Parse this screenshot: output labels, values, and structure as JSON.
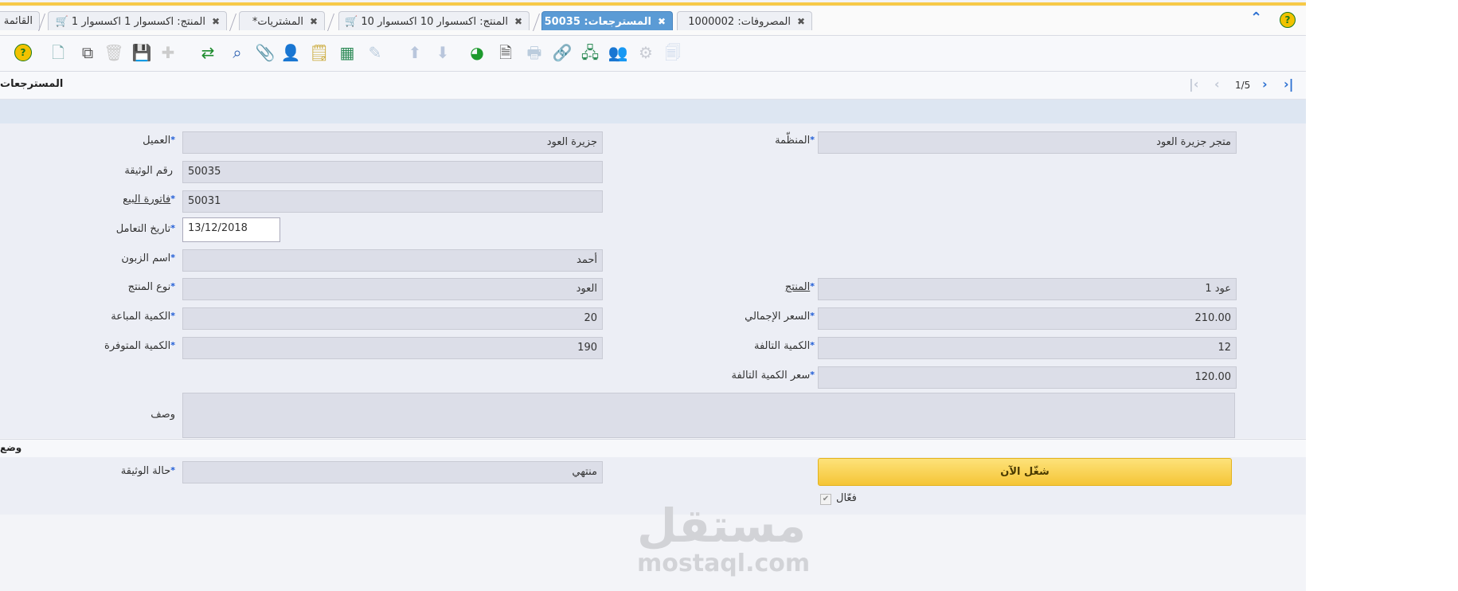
{
  "tabs": [
    {
      "label": "القائمة",
      "active": false
    },
    {
      "label": "المنتج: اكسسوار 1 اكسسوار 1",
      "active": false
    },
    {
      "label": "المشتريات*",
      "active": false
    },
    {
      "label": "المنتج: اكسسوار 10 اكسسوار 10",
      "active": false
    },
    {
      "label": "المسترجعات: 50035",
      "active": true
    },
    {
      "label": "المصروفات: 1000002",
      "active": false
    }
  ],
  "window": {
    "title": "المسترجعات",
    "pager": "1/5"
  },
  "form": {
    "client": {
      "label": "العميل",
      "value": "جزيرة العود"
    },
    "organization": {
      "label": "المنظّمة",
      "value": "متجر جزيرة العود"
    },
    "document_no": {
      "label": "رقم الوثيقة",
      "value": "50035"
    },
    "invoice": {
      "label": "فاتورة البيع",
      "value": "50031"
    },
    "transaction_date": {
      "label": "تاريخ التعامل",
      "value": "13/12/2018"
    },
    "customer_name": {
      "label": "اسم الزبون",
      "value": "أحمد"
    },
    "product_type": {
      "label": "نوع المنتج",
      "value": "العود"
    },
    "product": {
      "label": "المنتج",
      "value": "عود 1"
    },
    "qty_sold": {
      "label": "الكمية المباعة",
      "value": "20"
    },
    "total_price": {
      "label": "السعر الإجمالي",
      "value": "210.00"
    },
    "qty_available": {
      "label": "الكمية المتوفرة",
      "value": "190"
    },
    "qty_damaged": {
      "label": "الكمية التالفة",
      "value": "12"
    },
    "damaged_price": {
      "label": "سعر الكمية التالفة",
      "value": "120.00"
    },
    "description": {
      "label": "وصف",
      "value": ""
    }
  },
  "section": {
    "label": "وضع"
  },
  "status": {
    "label": "حالة الوثيقة",
    "value": "منتهي"
  },
  "run_button": {
    "label": "شغّل الآن"
  },
  "active": {
    "label": "فعّال",
    "checked": true
  },
  "watermark": {
    "arabic": "مستقل",
    "latin": "mostaql.com"
  },
  "colors": {
    "accent": "#f7c948",
    "active_tab": "#5b9bd5",
    "required": "#1e5bd6"
  }
}
